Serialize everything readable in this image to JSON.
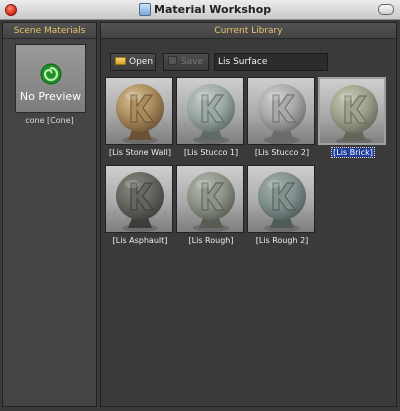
{
  "window": {
    "title": "Material Workshop"
  },
  "scene_panel": {
    "header": "Scene Materials",
    "thumbnail_text": "No Preview",
    "item_label": "cone [Cone]"
  },
  "library_panel": {
    "header": "Current Library",
    "open_label": "Open",
    "save_label": "Save",
    "library_name": "Lis Surface",
    "materials": [
      {
        "label": "[Lis Stone Wall]",
        "color_top": "#d9c49a",
        "color_mid": "#a8895c",
        "color_dark": "#6b5234",
        "selected": false
      },
      {
        "label": "[Lis Stucco 1]",
        "color_top": "#c7cfcb",
        "color_mid": "#9aa7a3",
        "color_dark": "#5f6a67",
        "selected": false
      },
      {
        "label": "[Lis Stucco 2]",
        "color_top": "#d2d2d2",
        "color_mid": "#a8a8a8",
        "color_dark": "#6b6b6b",
        "selected": false
      },
      {
        "label": "[Lis Brick]",
        "color_top": "#c9cbb8",
        "color_mid": "#9ea08c",
        "color_dark": "#64665a",
        "selected": true
      },
      {
        "label": "[Lis Asphault]",
        "color_top": "#8a8c84",
        "color_mid": "#62645d",
        "color_dark": "#3c3e39",
        "selected": false
      },
      {
        "label": "[Lis Rough]",
        "color_top": "#b8bcb2",
        "color_mid": "#8d9287",
        "color_dark": "#585d54",
        "selected": false
      },
      {
        "label": "[Lis Rough 2]",
        "color_top": "#a6b3b0",
        "color_mid": "#7f8f8c",
        "color_dark": "#4e5b59",
        "selected": false
      }
    ]
  },
  "icons": {
    "close": "close-icon",
    "app": "material-workshop-icon",
    "maximize": "maximize-icon",
    "folder": "folder-icon",
    "disk": "disk-icon",
    "no_preview_logo": "spiral-logo-icon"
  }
}
